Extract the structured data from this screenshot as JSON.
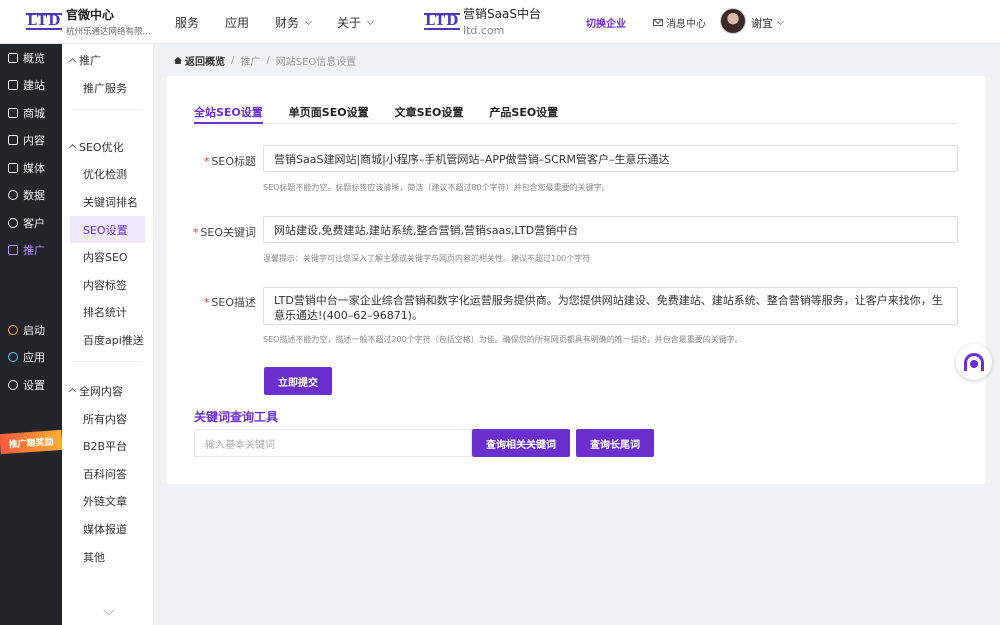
{
  "topbar": {
    "logo": "LTD",
    "brand_title": "官微中心",
    "brand_sub": "杭州乐通达网络有限...",
    "nav": [
      {
        "label": "服务",
        "dropdown": false
      },
      {
        "label": "应用",
        "dropdown": false
      },
      {
        "label": "财务",
        "dropdown": true
      },
      {
        "label": "关于",
        "dropdown": true
      }
    ],
    "saas_logo": "LTD",
    "saas_title": "营销SaaS中台",
    "saas_sub": "ltd.com",
    "switch": "切换企业",
    "messages": "消息中心",
    "username": "谢宜"
  },
  "sidebar": {
    "items": [
      {
        "label": "概览",
        "icon": "monitor-icon"
      },
      {
        "label": "建站",
        "icon": "home-icon"
      },
      {
        "label": "商城",
        "icon": "cart-icon"
      },
      {
        "label": "内容",
        "icon": "document-icon"
      },
      {
        "label": "媒体",
        "icon": "media-icon"
      },
      {
        "label": "数据",
        "icon": "clock-icon"
      },
      {
        "label": "客户",
        "icon": "user-icon"
      },
      {
        "label": "推广",
        "icon": "link-icon"
      }
    ],
    "items2": [
      {
        "label": "启动",
        "icon": "launch-icon"
      },
      {
        "label": "应用",
        "icon": "apps-icon"
      },
      {
        "label": "设置",
        "icon": "gear-icon"
      }
    ],
    "promo": "推广赚奖励"
  },
  "subnav": {
    "group1": "推广",
    "group1_items": [
      "推广服务"
    ],
    "group2": "SEO优化",
    "group2_items": [
      "优化检测",
      "关键词排名",
      "SEO设置",
      "内容SEO",
      "内容标签",
      "排名统计",
      "百度api推送"
    ],
    "group3": "全网内容",
    "group3_items": [
      "所有内容",
      "B2B平台",
      "百科问答",
      "外链文章",
      "媒体报道",
      "其他"
    ]
  },
  "breadcrumb": {
    "home": "返回概览",
    "sep": "/",
    "level1": "推广",
    "level2": "网站SEO信息设置"
  },
  "tabs": [
    "全站SEO设置",
    "单页面SEO设置",
    "文章SEO设置",
    "产品SEO设置"
  ],
  "form": {
    "title_label": "SEO标题",
    "title_value": "营销SaaS建网站|商城|小程序–手机管网站–APP做营销–SCRM管客户–生意乐通达",
    "title_tip": "SEO标题不能为空。标题标签应该清晰，简洁（建议不超过80个字符）并包含您最重要的关键字。",
    "keywords_label": "SEO关键词",
    "keywords_value": "网站建设,免费建站,建站系统,整合营销,营销saas,LTD营销中台",
    "keywords_tip": "温馨提示：关键字可让您深入了解主题或关键字与网页内容的相关性。建议不超过100个字符",
    "desc_label": "SEO描述",
    "desc_value": "LTD营销中台一家企业综合营销和数字化运营服务提供商。为您提供网站建设、免费建站、建站系统、整合营销等服务，让客户来找你，生意乐通达!(400–62–96871)。",
    "desc_tip": "SEO描述不能为空，描述一般不超过200个字符（包括空格）为佳。确保您的所有网页都具有明确的唯一描述，并包含最重要的关键字。",
    "submit": "立即提交"
  },
  "keyword_tool": {
    "title": "关键词查询工具",
    "placeholder": "输入基本关键词",
    "btn_related": "查询相关关键词",
    "btn_longtail": "查询长尾词"
  },
  "colors": {
    "accent": "#6b2fd0",
    "sidebar": "#24252b"
  }
}
